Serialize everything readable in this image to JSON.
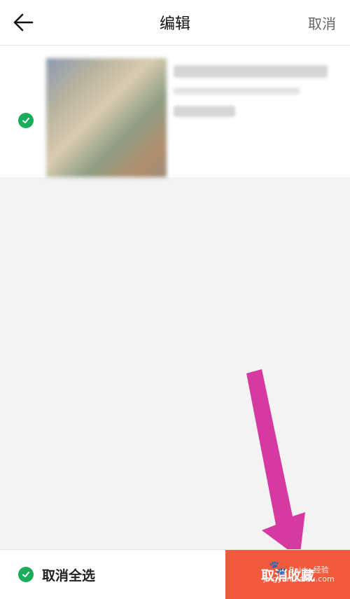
{
  "header": {
    "title": "编辑",
    "cancel_label": "取消",
    "back_icon": "back-arrow-icon"
  },
  "list": {
    "items": [
      {
        "selected": true,
        "check_icon": "check-circle-icon"
      }
    ]
  },
  "footer": {
    "select_all_label": "取消全选",
    "primary_label": "取消收藏",
    "primary_color": "#f25a3b",
    "check_color": "#1aad5c"
  },
  "annotation": {
    "arrow_color": "#d63aa0"
  },
  "watermark": {
    "brand": "Baidu 经验",
    "url": "jingyan.baidu.com"
  }
}
